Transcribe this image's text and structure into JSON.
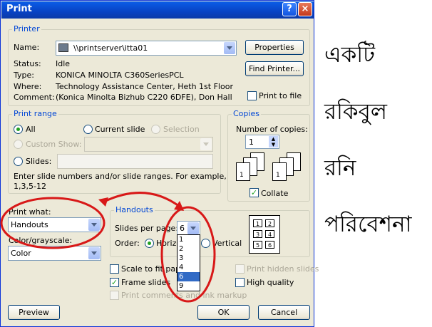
{
  "window": {
    "title": "Print",
    "help_icon": "?",
    "close_icon": "×"
  },
  "printer": {
    "group_label": "Printer",
    "name_label": "Name:",
    "name_value": "\\\\printserver\\itta01",
    "properties_label": "Properties",
    "find_printer_label": "Find Printer...",
    "status_label": "Status:",
    "status_value": "Idle",
    "type_label": "Type:",
    "type_value": "KONICA MINOLTA C360SeriesPCL",
    "where_label": "Where:",
    "where_value": "Technology Assistance Center, Heth 1st Floor",
    "comment_label": "Comment:",
    "comment_value": "(Konica Minolta Bizhub C220 6DFE), Don Hall",
    "print_to_file_label": "Print to file"
  },
  "print_range": {
    "group_label": "Print range",
    "all_label": "All",
    "current_slide_label": "Current slide",
    "selection_label": "Selection",
    "custom_show_label": "Custom Show:",
    "slides_label": "Slides:",
    "help_text_1": "Enter slide numbers and/or slide ranges. For example,",
    "help_text_2": "1,3,5-12"
  },
  "copies": {
    "group_label": "Copies",
    "number_label": "Number of copies:",
    "number_value": "1",
    "collate_label": "Collate"
  },
  "print_what": {
    "label": "Print what:",
    "value": "Handouts"
  },
  "color": {
    "label": "Color/grayscale:",
    "value": "Color"
  },
  "handouts": {
    "group_label": "Handouts",
    "slides_per_page_label": "Slides per page:",
    "slides_per_page_value": "6",
    "options": [
      "1",
      "2",
      "3",
      "4",
      "6",
      "9"
    ],
    "selected_option": "6",
    "order_label": "Order:",
    "horizontal_label": "Horizontal",
    "vertical_label": "Vertical",
    "preview_numbers": [
      "1",
      "2",
      "3",
      "4",
      "5",
      "6"
    ]
  },
  "options": {
    "scale_to_fit_label": "Scale to fit paper",
    "frame_slides_label": "Frame slides",
    "print_comments_label": "Print comments and ink markup",
    "print_hidden_label": "Print hidden slides",
    "high_quality_label": "High quality"
  },
  "buttons": {
    "preview": "Preview",
    "ok": "OK",
    "cancel": "Cancel"
  },
  "annotations": {
    "words": [
      "একটি",
      "রকিবুল",
      "রনি",
      "পরিবেশনা"
    ],
    "circle_color": "#d81818"
  }
}
